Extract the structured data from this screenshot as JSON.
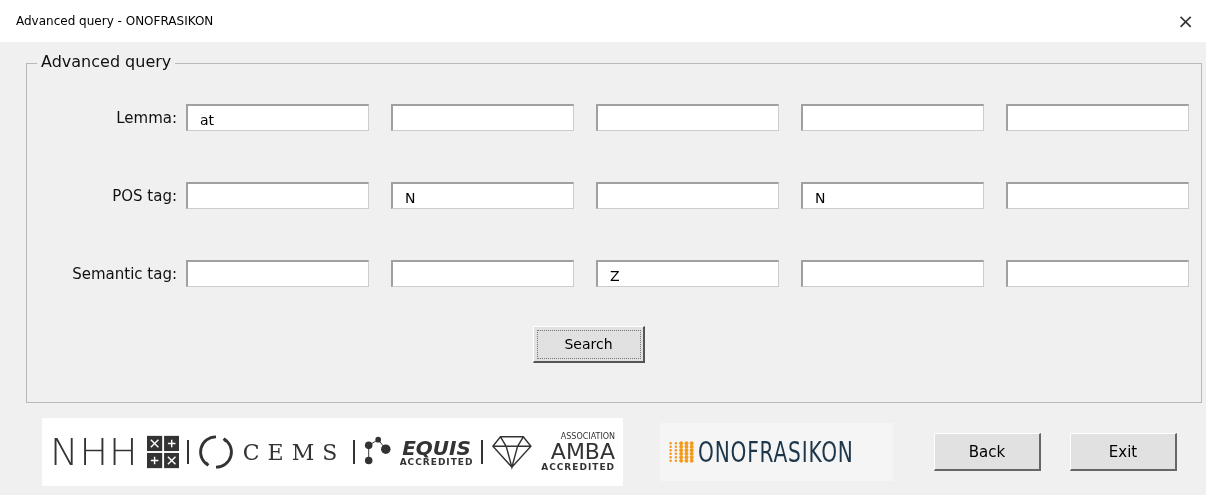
{
  "window": {
    "title": "Advanced query - ONOFRASIKON",
    "close": "×"
  },
  "group": {
    "title": "Advanced query"
  },
  "rows": [
    {
      "label": "Lemma:",
      "fields": [
        {
          "kind": "filled",
          "value": "at"
        },
        {
          "kind": "empty"
        },
        {
          "kind": "empty"
        },
        {
          "kind": "empty"
        },
        {
          "kind": "empty"
        }
      ]
    },
    {
      "label": "POS tag:",
      "fields": [
        {
          "kind": "empty"
        },
        {
          "kind": "filled",
          "value": "N"
        },
        {
          "kind": "empty"
        },
        {
          "kind": "filled",
          "value": "N"
        },
        {
          "kind": "empty"
        }
      ]
    },
    {
      "label": "Semantic tag:",
      "fields": [
        {
          "kind": "empty"
        },
        {
          "kind": "empty"
        },
        {
          "kind": "filled",
          "value": "Z"
        },
        {
          "kind": "empty"
        },
        {
          "kind": "empty"
        }
      ]
    }
  ],
  "search_button": "Search",
  "logos": {
    "nhh": "NHH",
    "cems": "CEMS",
    "equis": "EQUIS",
    "equis_sub": "ACCREDITED",
    "amba_top": "ASSOCIATION",
    "amba": "AMBA",
    "amba_sub": "ACCREDITED"
  },
  "brand": "ONOFRASIKON",
  "buttons": [
    "Back",
    "Exit"
  ]
}
